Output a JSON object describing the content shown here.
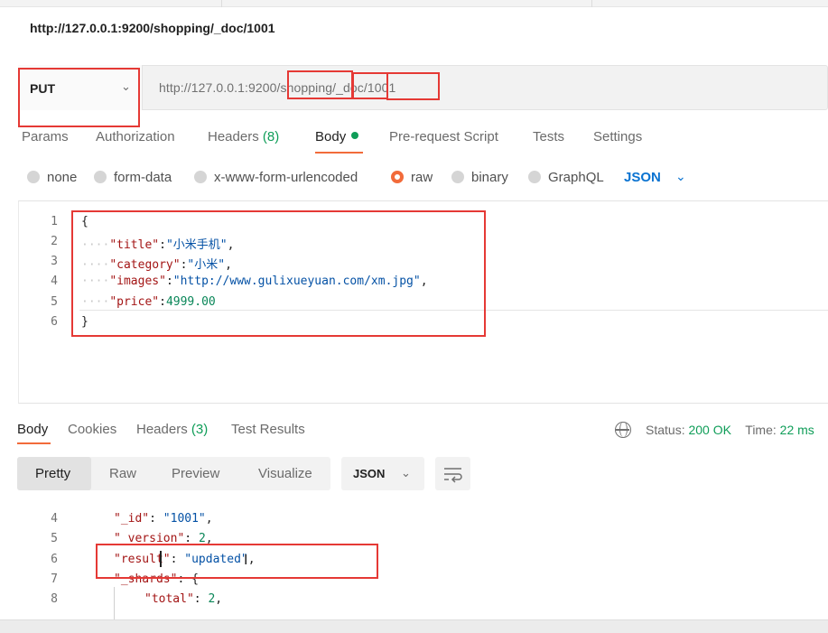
{
  "window": {
    "title_url": "http://127.0.0.1:9200/shopping/_doc/1001"
  },
  "request": {
    "method": "PUT",
    "url": "http://127.0.0.1:9200/shopping/_doc/1001",
    "url_parts": [
      "http://127.0.0.1:9200/",
      "shopping",
      "/",
      "_doc",
      "/",
      "1001"
    ]
  },
  "request_tabs": [
    {
      "label": "Params"
    },
    {
      "label": "Authorization"
    },
    {
      "label": "Headers",
      "count": "(8)"
    },
    {
      "label": "Body",
      "active": true
    },
    {
      "label": "Pre-request Script"
    },
    {
      "label": "Tests"
    },
    {
      "label": "Settings"
    }
  ],
  "body_types": [
    {
      "label": "none"
    },
    {
      "label": "form-data"
    },
    {
      "label": "x-www-form-urlencoded"
    },
    {
      "label": "raw",
      "selected": true
    },
    {
      "label": "binary"
    },
    {
      "label": "GraphQL"
    }
  ],
  "body_format": "JSON",
  "request_body_lines": [
    {
      "n": "1",
      "text": "{"
    },
    {
      "n": "2",
      "key": "\"title\"",
      "value": "\"小米手机\"",
      "tail": ","
    },
    {
      "n": "3",
      "key": "\"category\"",
      "value": "\"小米\"",
      "tail": ","
    },
    {
      "n": "4",
      "key": "\"images\"",
      "value": "\"http://www.gulixueyuan.com/xm.jpg\"",
      "tail": ","
    },
    {
      "n": "5",
      "key": "\"price\"",
      "number": "4999.00"
    },
    {
      "n": "6",
      "text": "}"
    }
  ],
  "response_tabs": [
    {
      "label": "Body",
      "active": true
    },
    {
      "label": "Cookies"
    },
    {
      "label": "Headers",
      "count": "(3)"
    },
    {
      "label": "Test Results"
    }
  ],
  "response_status": {
    "status_label": "Status:",
    "status_value": "200 OK",
    "time_label": "Time:",
    "time_value": "22 ms"
  },
  "view_modes": [
    "Pretty",
    "Raw",
    "Preview",
    "Visualize"
  ],
  "response_format": "JSON",
  "response_lines": [
    {
      "n": "4",
      "key": "\"_id\"",
      "value": "\"1001\"",
      "tail": ","
    },
    {
      "n": "5",
      "key": "\"_version\"",
      "number": "2",
      "tail": ","
    },
    {
      "n": "6",
      "key": "\"result\"",
      "value": "\"updated\"",
      "tail": ","
    },
    {
      "n": "7",
      "key": "\"_shards\"",
      "tail": ": {"
    },
    {
      "n": "8",
      "key": "\"total\"",
      "number": "2",
      "tail": ","
    }
  ],
  "colors": {
    "accent": "#f26b3a",
    "success": "#0f9d58",
    "highlight_box": "#e53935",
    "link_blue": "#0b73d1"
  }
}
